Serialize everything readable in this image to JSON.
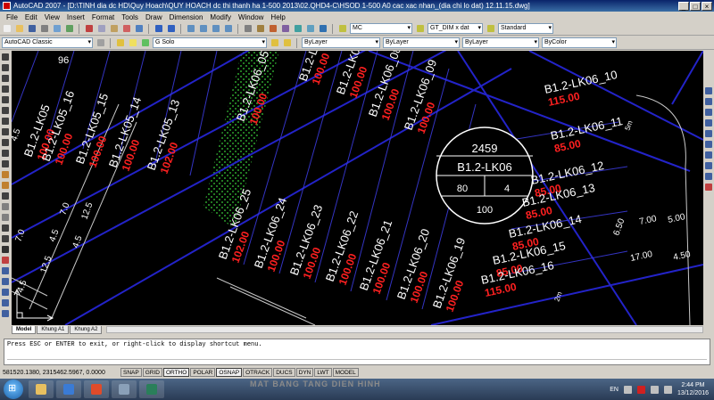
{
  "window": {
    "title": "AutoCAD 2007 - [D:\\TINH dia dc HD\\Quy Hoach\\QUY HOACH dc thi thanh ha 1-500 2013\\02.QHD4-C\\HSOD 1-500 A0 cac xac nhan_(dia chi lo dat) 12.11.15.dwg]",
    "controls": [
      "_",
      "□",
      "×"
    ]
  },
  "menu": [
    "File",
    "Edit",
    "View",
    "Insert",
    "Format",
    "Tools",
    "Draw",
    "Dimension",
    "Modify",
    "Window",
    "Help"
  ],
  "toolbar": {
    "text_style": "MC",
    "dim_style": "GT_DIM x dat",
    "table_style": "Standard",
    "workspace": "AutoCAD Classic",
    "layer": "G Solo",
    "color": "ByLayer",
    "linetype": "ByLayer",
    "lineweight": "ByLayer",
    "plotstyle": "ByColor"
  },
  "drawing": {
    "lot_labels": [
      "B1.2-LK05",
      "B1.2-LK05_16",
      "B1.2-LK05_15",
      "B1.2-LK05_14",
      "B1.2-LK05_13",
      "B1.2-LK06_25",
      "B1.2-LK06_24",
      "B1.2-LK06_23",
      "B1.2-LK06_22",
      "B1.2-LK06_21",
      "B1.2-LK06_20",
      "B1.2-LK06_19",
      "B1.2-LK06_05",
      "B1.2-LK06_06",
      "B1.2-LK06_07",
      "B1.2-LK06_08",
      "B1.2-LK06_09",
      "B1.2-LK06_10",
      "B1.2-LK06_11",
      "B1.2-LK06_12",
      "B1.2-LK06_13",
      "B1.2-LK06_14",
      "B1.2-LK06_15",
      "B1.2-LK06_16"
    ],
    "areas": [
      "100.00",
      "100.00",
      "100.00",
      "100.00",
      "102.00",
      "102.00",
      "100.00",
      "100.00",
      "100.00",
      "100.00",
      "100.00",
      "100.00",
      "100.00",
      "100.00",
      "100.00",
      "100.00",
      "100.00",
      "115.00",
      "85.00",
      "85.00",
      "85.00",
      "85.00",
      "85.00",
      "115.00"
    ],
    "block_id": "2459",
    "block_name": "B1.2-LK06",
    "block_density": "80",
    "block_floors": "4",
    "block_height": "100",
    "dims_left": [
      "7.0",
      "4.5",
      "12.5",
      "4.5",
      "7.0",
      "12.5",
      "4.5",
      "4.5"
    ],
    "dims_right": [
      "7.00",
      "5.00",
      "6.50",
      "17.00",
      "4.50"
    ],
    "label_96": "96",
    "label_5m": "5m",
    "label_2m": "2m"
  },
  "tabs": [
    "Model",
    "Khung A1",
    "Khung A2"
  ],
  "command": {
    "prompt": "Press ESC or ENTER to exit, or right-click to display shortcut menu."
  },
  "status": {
    "coords": "581520.1380, 2315462.5967, 0.0000",
    "buttons": [
      "SNAP",
      "GRID",
      "ORTHO",
      "POLAR",
      "OSNAP",
      "OTRACK",
      "DUCS",
      "DYN",
      "LWT",
      "MODEL"
    ]
  },
  "taskbar": {
    "banner": "MAT BANG TANG DIEN HINH",
    "lang": "EN",
    "time": "2:44 PM",
    "date": "13/12/2016"
  },
  "colors": {
    "lot_label": "#ffffff",
    "area_text": "#ff2020",
    "road_line": "#2323c8",
    "hatch": "#2ca02c"
  }
}
